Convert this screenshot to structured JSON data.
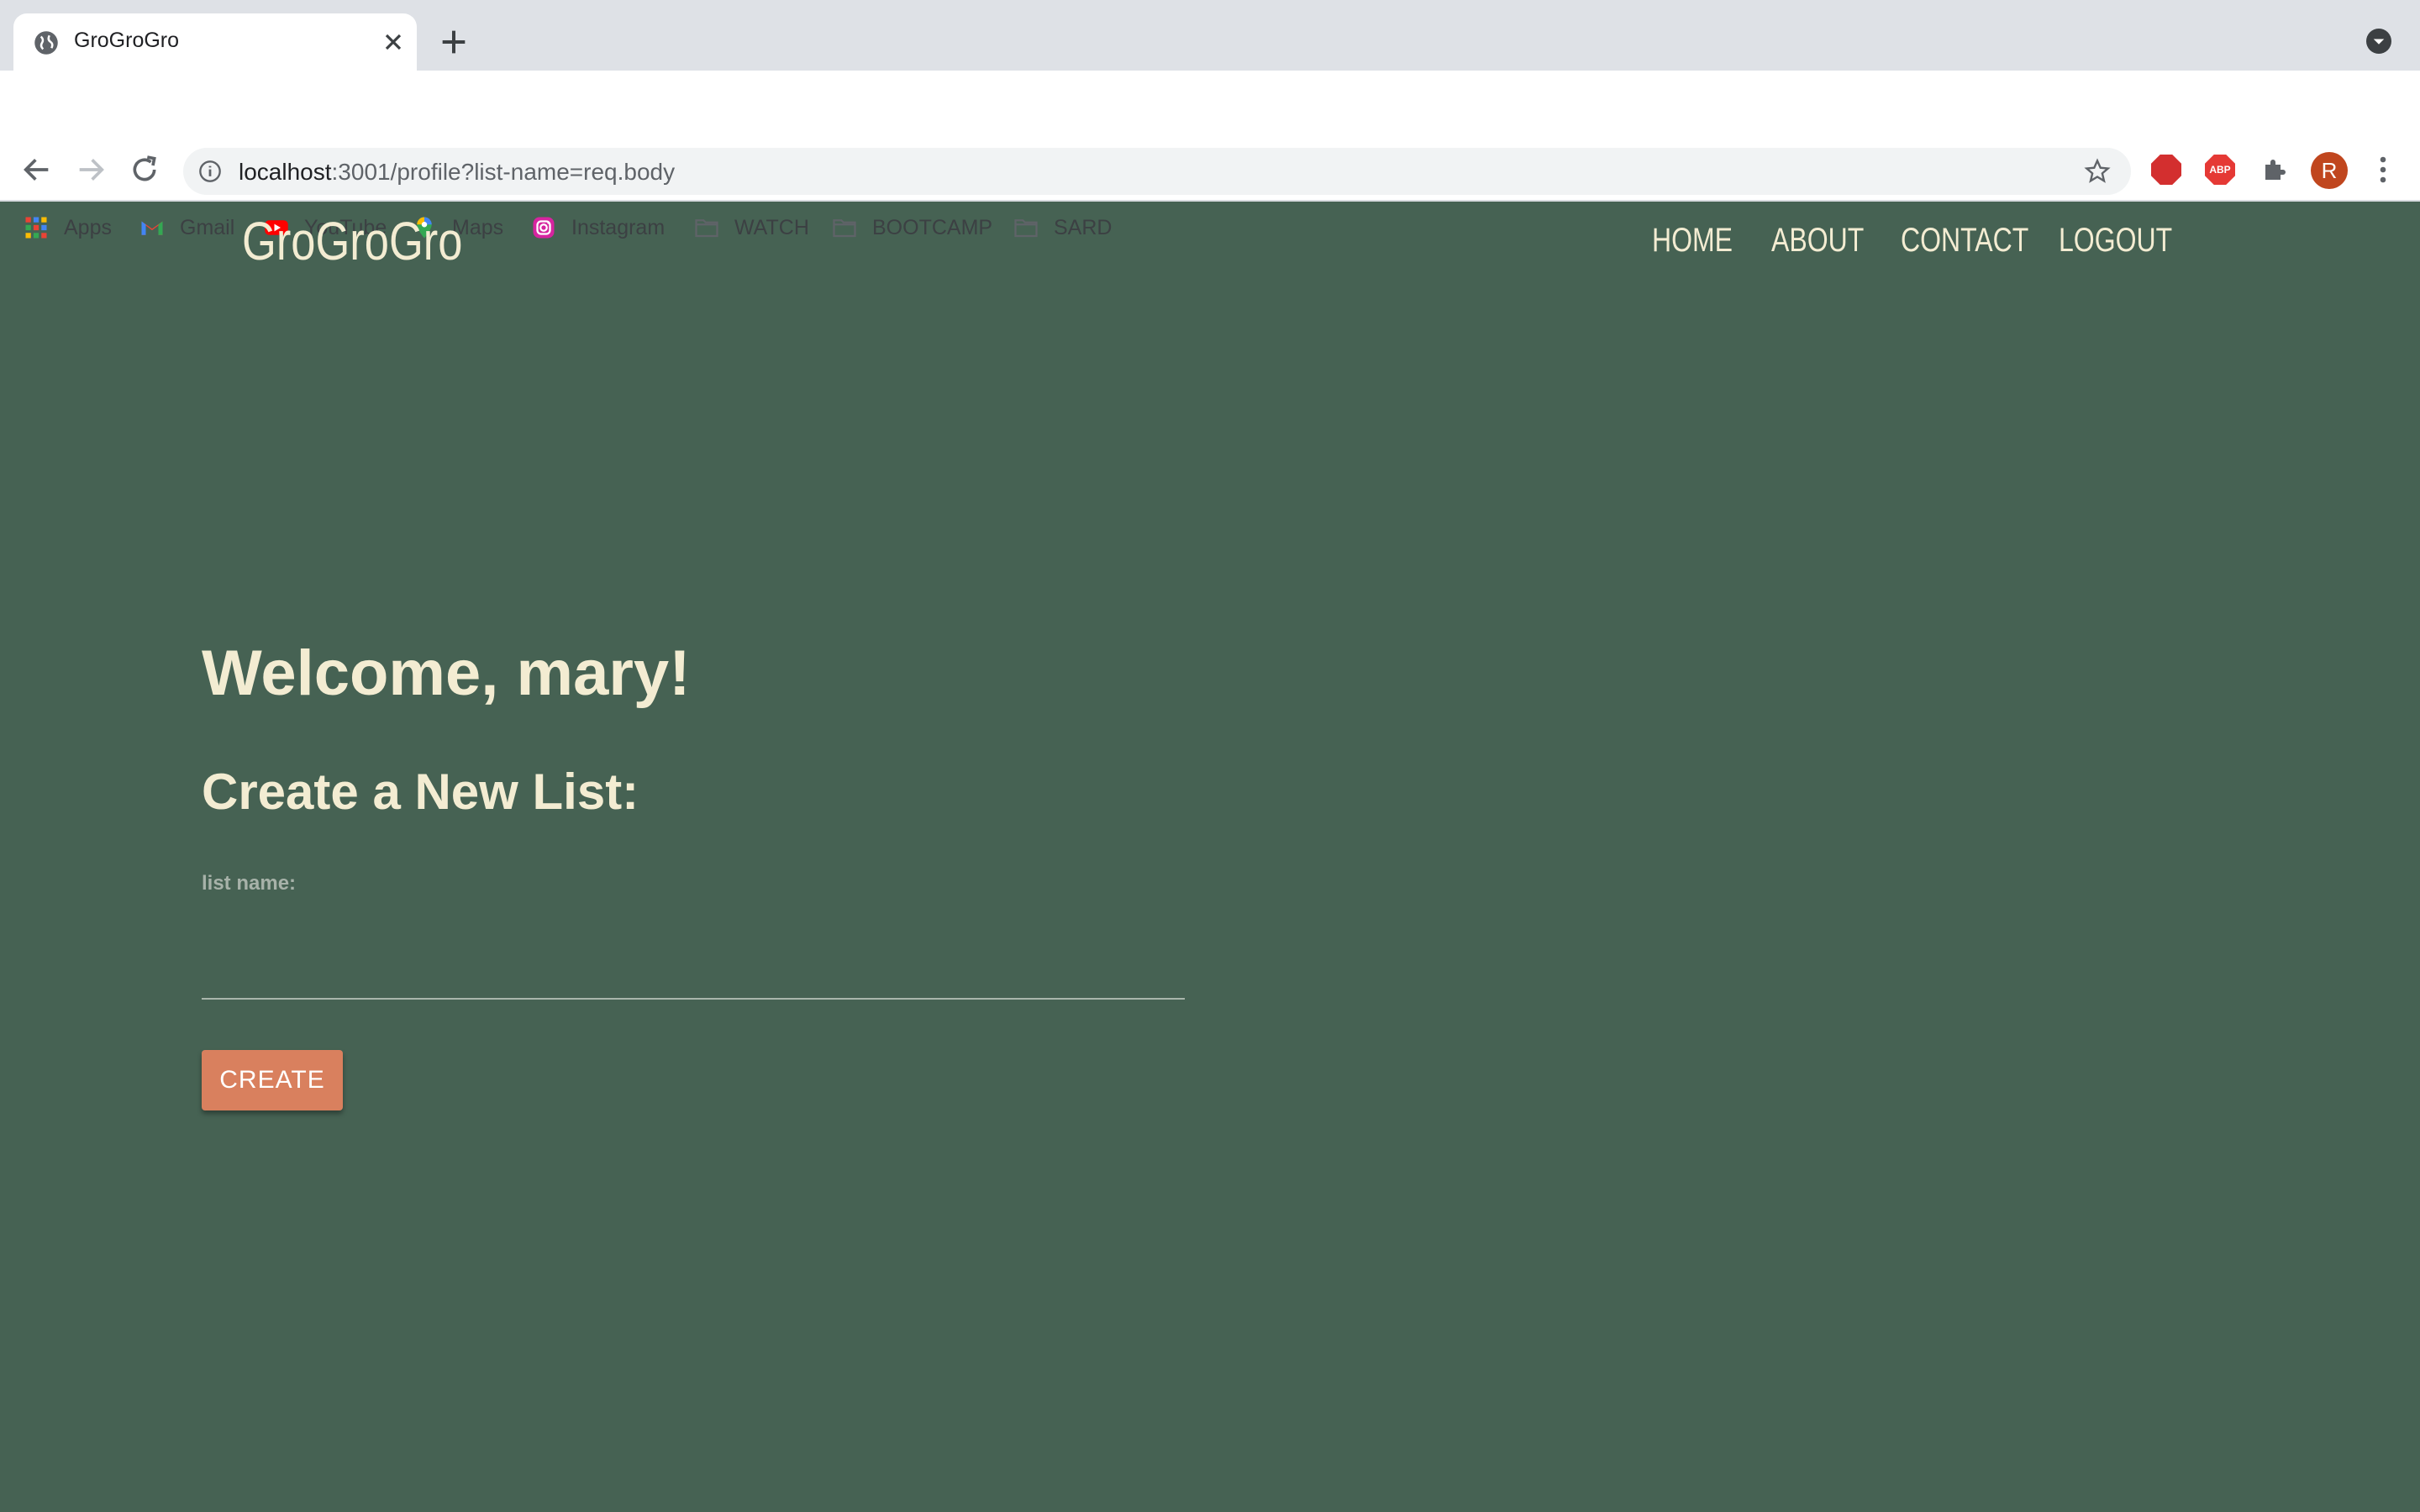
{
  "browser": {
    "tab": {
      "title": "GroGroGro"
    },
    "address": {
      "host": "localhost",
      "path": ":3001/profile?list-name=req.body"
    },
    "profile_initial": "R",
    "extensions": {
      "adblock_label": "ABP"
    },
    "bookmarks": [
      {
        "label": "Apps",
        "icon": "apps-grid-icon"
      },
      {
        "label": "Gmail",
        "icon": "gmail-icon"
      },
      {
        "label": "YouTube",
        "icon": "youtube-icon"
      },
      {
        "label": "Maps",
        "icon": "maps-pin-icon"
      },
      {
        "label": "Instagram",
        "icon": "instagram-icon"
      },
      {
        "label": "WATCH",
        "icon": "folder-icon"
      },
      {
        "label": "BOOTCAMP",
        "icon": "folder-icon"
      },
      {
        "label": "SARD",
        "icon": "folder-icon"
      }
    ]
  },
  "site": {
    "logo": "GroGroGro",
    "nav": [
      "HOME",
      "ABOUT",
      "CONTACT",
      "LOGOUT"
    ]
  },
  "main": {
    "welcome": "Welcome, mary!",
    "create_heading": "Create a New List:",
    "list_name_label": "list name:",
    "list_name_value": "",
    "create_button": "CREATE"
  },
  "colors": {
    "page_background": "#466253",
    "text_cream": "#f3ecd2",
    "button": "#d9805e",
    "label_muted": "#a7b2a9"
  }
}
